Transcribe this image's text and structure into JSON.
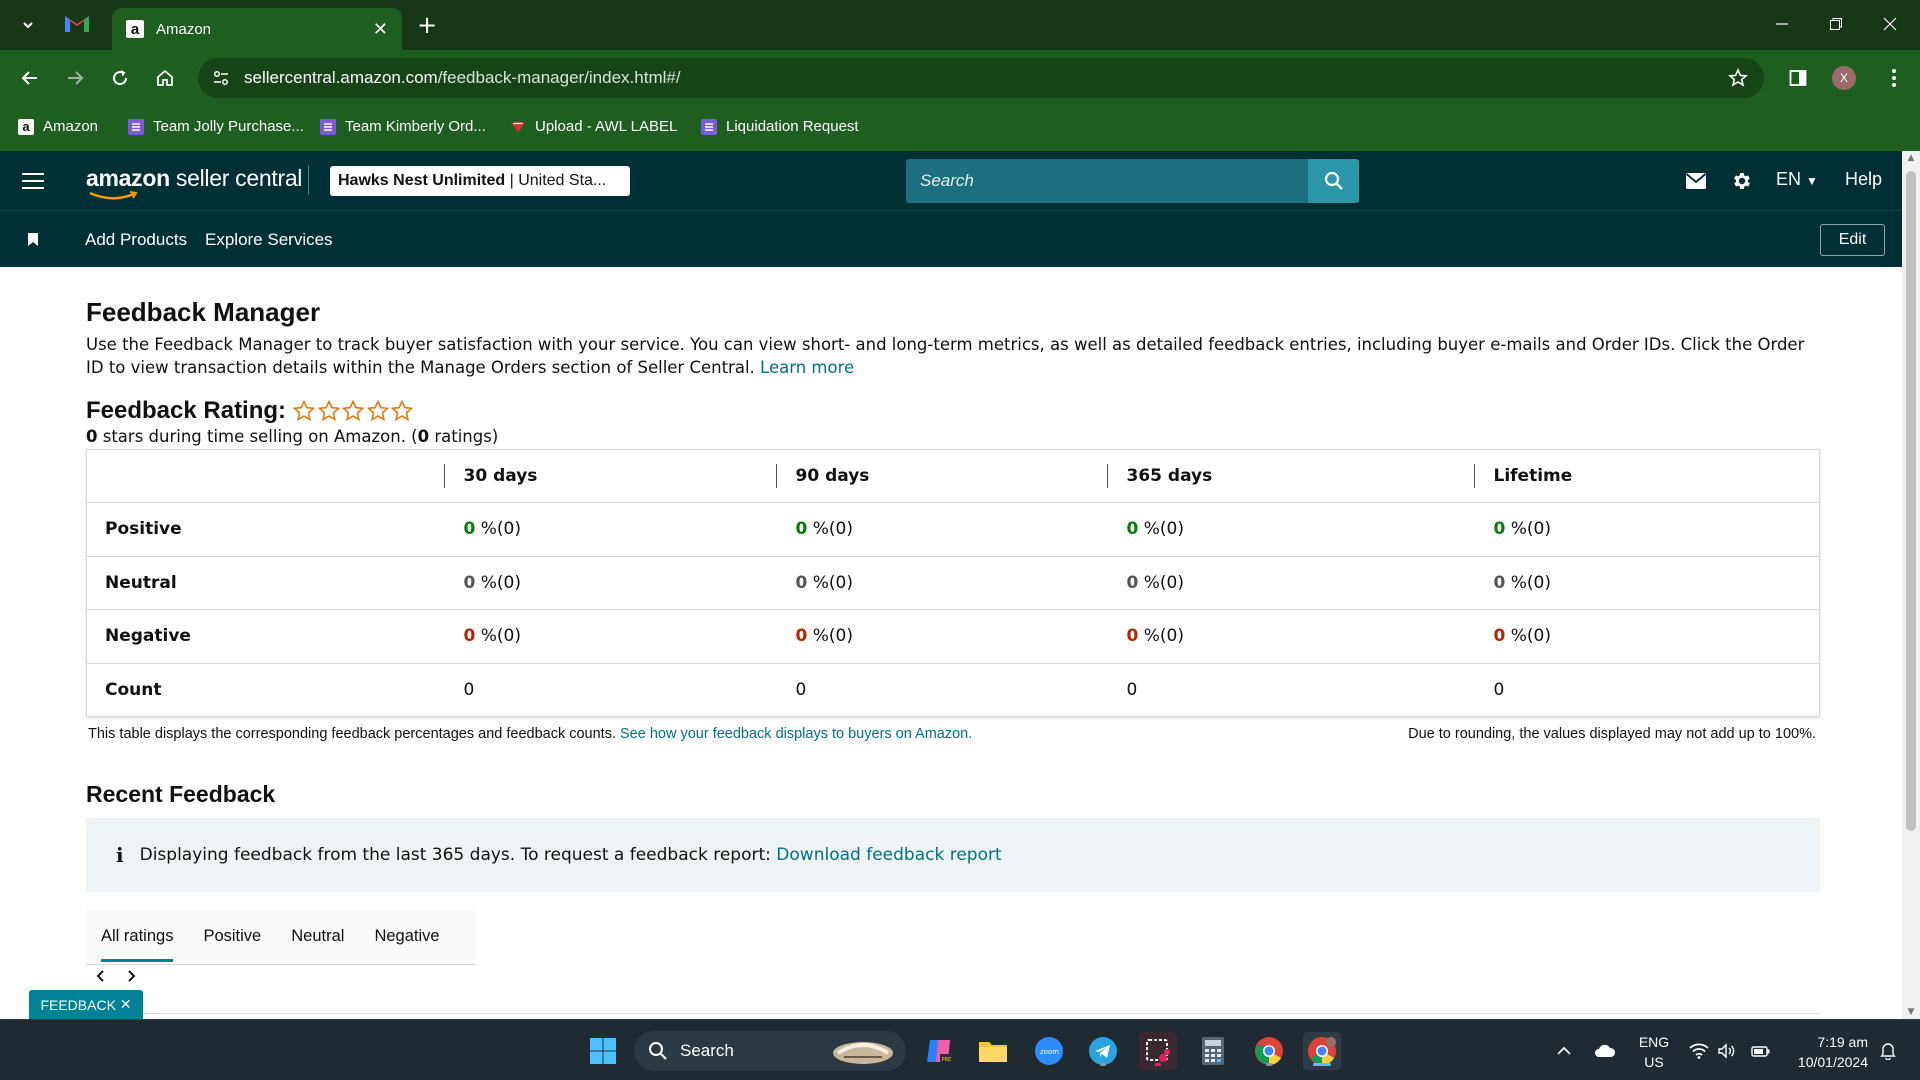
{
  "browser": {
    "tab_title": "Amazon",
    "url_host": "sellercentral.amazon.com",
    "url_path": "/feedback-manager/index.html#/",
    "profile_initial": "X",
    "bookmarks": [
      {
        "label": "Amazon",
        "icon": "amazon-icon"
      },
      {
        "label": "Team Jolly Purchase...",
        "icon": "list-icon"
      },
      {
        "label": "Team Kimberly Ord...",
        "icon": "list-icon"
      },
      {
        "label": "Upload - AWL LABEL",
        "icon": "label-icon"
      },
      {
        "label": "Liquidation Request",
        "icon": "list-icon"
      }
    ]
  },
  "header": {
    "logo_bold": "amazon",
    "logo_rest": " seller central",
    "store_name": "Hawks Nest Unlimited",
    "store_region": " | United Sta...",
    "search_placeholder": "Search",
    "language": "EN",
    "help": "Help"
  },
  "subnav": {
    "links": [
      "Add Products",
      "Explore Services"
    ],
    "edit_label": "Edit"
  },
  "page": {
    "title": "Feedback Manager",
    "intro": "Use the Feedback Manager to track buyer satisfaction with your service. You can view short- and long-term metrics, as well as detailed feedback entries, including buyer e-mails and Order IDs. Click the Order ID to view transaction details within the Manage Orders section of Seller Central.",
    "learn_more": "Learn more",
    "rating_title": "Feedback Rating:",
    "stars_filled": 0,
    "stars_total": 5,
    "rating_stars": "0",
    "rating_mid": " stars during time selling on Amazon. (",
    "rating_count": "0",
    "rating_end": " ratings)"
  },
  "feedback_table": {
    "columns": [
      "30 days",
      "90 days",
      "365 days",
      "Lifetime"
    ],
    "rows": [
      {
        "label": "Positive",
        "values": [
          "0",
          "0",
          "0",
          "0"
        ],
        "suffix": " %(0)"
      },
      {
        "label": "Neutral",
        "values": [
          "0",
          "0",
          "0",
          "0"
        ],
        "suffix": " %(0)"
      },
      {
        "label": "Negative",
        "values": [
          "0",
          "0",
          "0",
          "0"
        ],
        "suffix": " %(0)"
      },
      {
        "label": "Count",
        "values": [
          "0",
          "0",
          "0",
          "0"
        ],
        "suffix": ""
      }
    ],
    "note": "This table displays the corresponding feedback percentages and feedback counts.",
    "note_link": "See how your feedback displays to buyers on Amazon.",
    "note_right": "Due to rounding, the values displayed may not add up to 100%."
  },
  "recent": {
    "title": "Recent Feedback",
    "info_text": "Displaying feedback from the last 365 days. To request a feedback report:",
    "info_link": "Download feedback report",
    "tabs": [
      "All ratings",
      "Positive",
      "Neutral",
      "Negative"
    ],
    "active_tab": "All ratings"
  },
  "feedback_tag": "FEEDBACK",
  "taskbar": {
    "search_label": "Search",
    "language": "ENG",
    "region": "US",
    "time": "7:19 am",
    "date": "10/01/2024"
  },
  "colors": {
    "chrome_dark": "#163816",
    "chrome": "#1e5e1e",
    "seller_header": "#002f36",
    "link": "#007185",
    "positive": "#067d06",
    "negative": "#b12704",
    "star": "#e47911"
  }
}
